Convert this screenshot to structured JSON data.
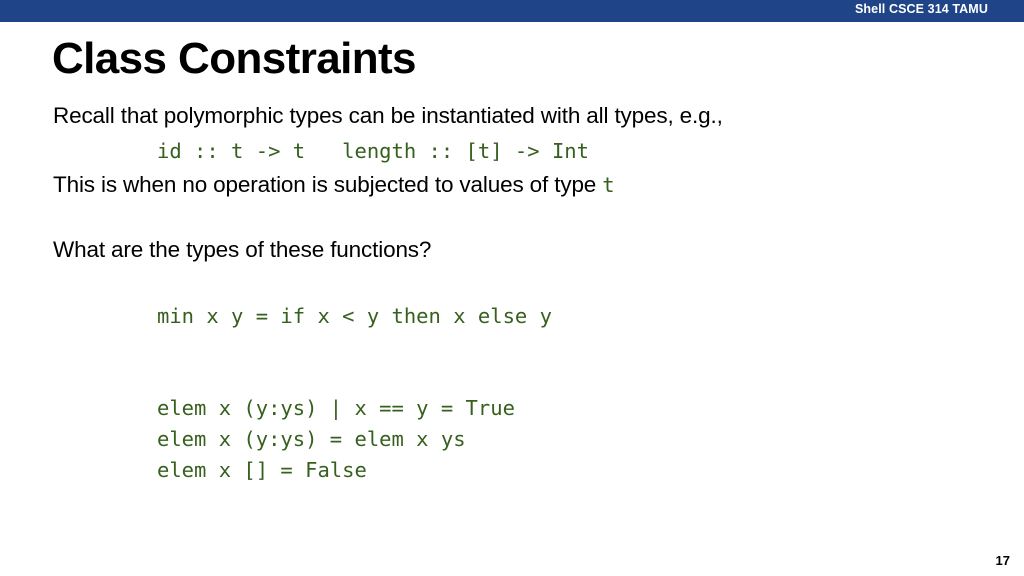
{
  "banner": {
    "text": "Shell CSCE 314 TAMU",
    "background_color": "#1f4487",
    "text_color": "#ffffff"
  },
  "slide": {
    "title": "Class Constraints",
    "body": {
      "recall_line": "Recall that polymorphic types can be instantiated with all types, e.g.,",
      "signatures_line": "id :: t -> t   length :: [t] -> Int",
      "this_is_prefix": "This is when no operation is subjected to values of type ",
      "this_is_type": "t",
      "question_line": "What are the types of these functions?",
      "min_definition": "min x y = if x < y then x else y",
      "elem_line_1": "elem x (y:ys) | x == y = True",
      "elem_line_2": "elem x (y:ys) = elem x ys",
      "elem_line_3": "elem x [] = False"
    },
    "code_color": "#37601e",
    "text_color": "#000000",
    "background_color": "#ffffff"
  },
  "footer": {
    "page_number": "17"
  }
}
